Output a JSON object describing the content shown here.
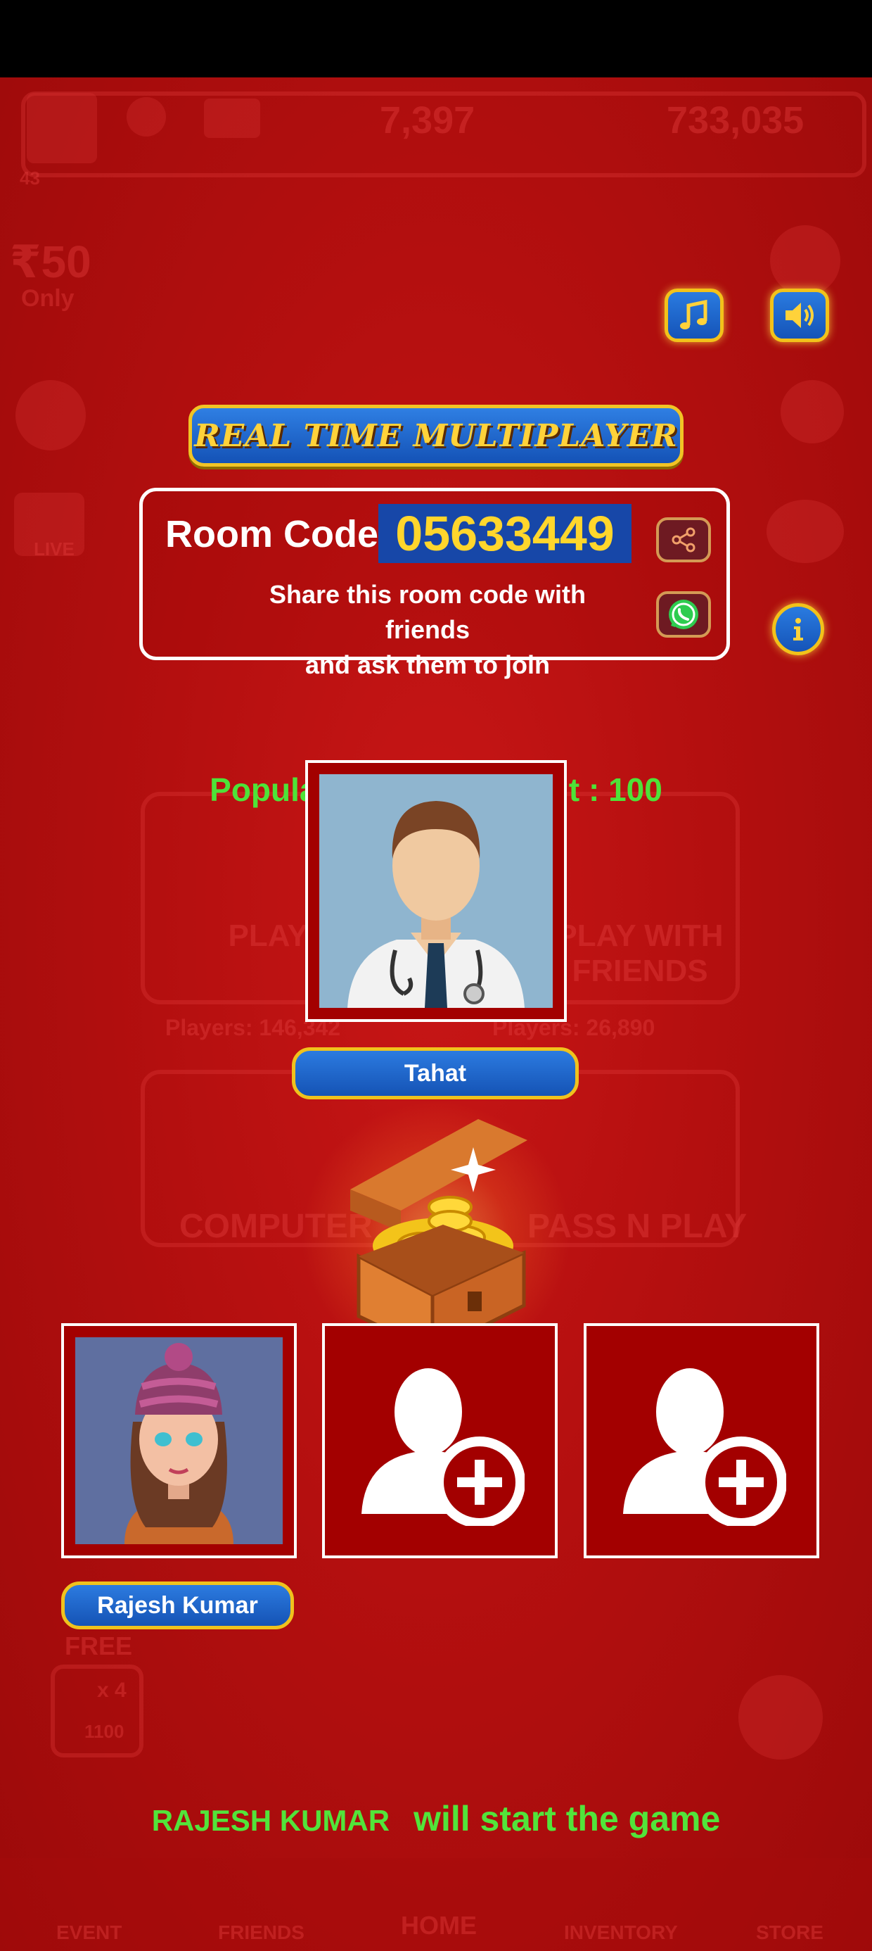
{
  "background": {
    "gems": "7,397",
    "coins": "733,035",
    "level": "43",
    "offer_price": "₹50",
    "offer_suffix": "Only",
    "badge_live": "LIVE",
    "tile_online": "PLAY ONLINE",
    "tile_friends": "PLAY WITH FRIENDS",
    "players_online": "Players: 146,342",
    "players_friends": "Players: 26,890",
    "tile_computer": "COMPUTER",
    "tile_pass": "PASS N PLAY",
    "free_label": "FREE",
    "ad_multiplier": "x 4",
    "ad_reward": "1100",
    "nav": [
      "EVENT",
      "FRIENDS",
      "HOME",
      "INVENTORY",
      "STORE"
    ]
  },
  "banner": {
    "title": "REAL TIME MULTIPLAYER"
  },
  "room": {
    "label": "Room Code :",
    "code": "05633449",
    "hint_line1": "Share this room code with friends",
    "hint_line2": "and ask them to join"
  },
  "entry": {
    "text": "Popular > Entry Amount : 100"
  },
  "host": {
    "name": "Tahat"
  },
  "players": [
    {
      "name": "Rajesh Kumar"
    }
  ],
  "footer": {
    "starter_name": "RAJESH KUMAR",
    "starter_text": "will start the game"
  },
  "icons": {
    "music": "music-note-icon",
    "sound": "speaker-icon",
    "share": "share-icon",
    "whatsapp": "whatsapp-icon",
    "info": "info-icon",
    "add_player": "add-user-icon"
  },
  "colors": {
    "background_red": "#b40f0f",
    "button_blue": "#1553b5",
    "gold_border": "#f0c21d",
    "code_yellow": "#ffd62c",
    "accent_green": "#4ee338"
  }
}
